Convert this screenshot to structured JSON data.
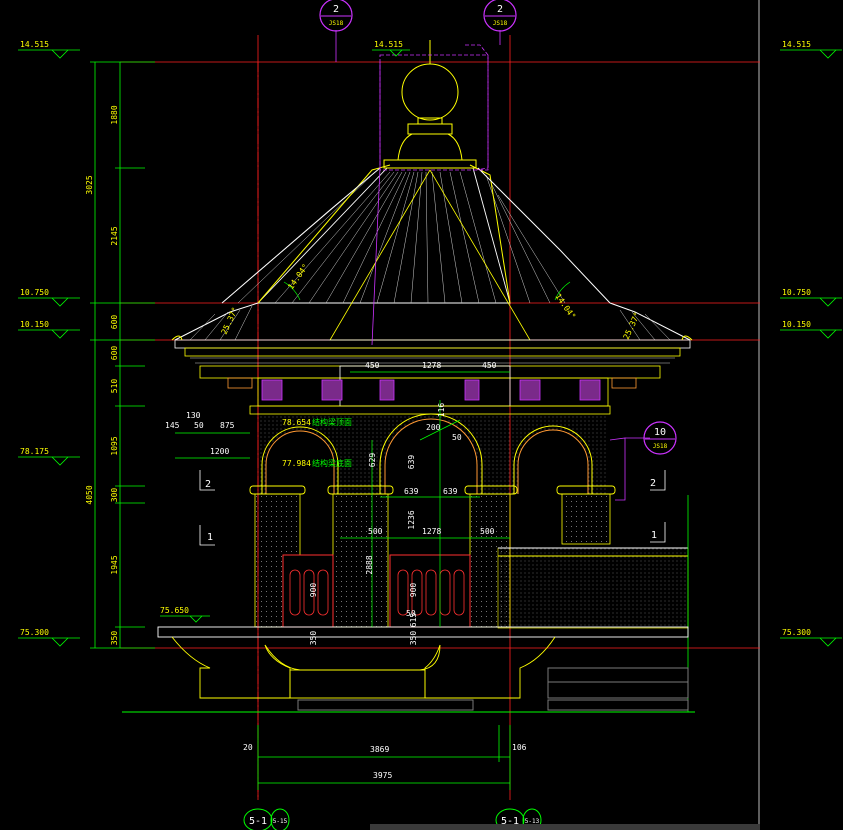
{
  "palette": {
    "background": "#000000",
    "structure": "#ffff00",
    "dimension": "#00ff00",
    "axis": "#ff2020",
    "callout": "#cc33ff",
    "roof": "#ffffff",
    "orange": "#ff9933",
    "gray": "#7a7a7a",
    "cyan": "#00ffff"
  },
  "callouts": {
    "top_left": {
      "num": "2",
      "sheet": "JS18"
    },
    "top_right": {
      "num": "2",
      "sheet": "JS18"
    },
    "right": {
      "num": "10",
      "sheet": "JS18"
    }
  },
  "levels": {
    "top": "14.515",
    "top_center": "14.515",
    "eave_upper": "10.750",
    "eave_lower": "10.150",
    "mid": "78.175",
    "base_left": "75.300",
    "base_center": "75.650"
  },
  "left_dims": {
    "outer": [
      "3025",
      "4050"
    ],
    "inner": [
      "1880",
      "2145",
      "600",
      "600",
      "510",
      "1095",
      "300",
      "1945",
      "350"
    ]
  },
  "dims": {
    "top_450_left": "450",
    "top_1278": "1278",
    "top_450_right": "450",
    "d145": "145",
    "d130": "130",
    "d50": "50",
    "d875": "875",
    "d1200": "1200",
    "mid_500_left": "500",
    "mid_1278": "1278",
    "mid_500_right": "500",
    "d639a": "639",
    "d639b": "639",
    "d1236": "1236",
    "d2888": "2888",
    "d900a": "900",
    "d900b": "900",
    "d350a": "350",
    "d350b": "350",
    "d116": "116",
    "d200": "200",
    "d50b": "50",
    "d629": "629",
    "d639v": "639",
    "d615": "615",
    "d50c": "50",
    "bottom_20": "20",
    "bottom_3869": "3869",
    "bottom_106": "106",
    "bottom_3975": "3975",
    "angle_left": "14.04°",
    "angle_right": "14.04°",
    "angle_eave_left": "25.37°",
    "angle_eave_right": "25.37°"
  },
  "labels": {
    "struct_top": "结构梁顶面",
    "struct_top_elev": "78.654",
    "struct_bottom": "结构梁底面",
    "struct_bottom_elev": "77.984",
    "section_left_upper": "2",
    "section_left_lower": "1",
    "section_right_upper": "2",
    "section_right_lower": "1"
  },
  "axes": {
    "left": "5-1",
    "left_sub": "5-15",
    "right": "5-1",
    "right_sub": "5-13"
  }
}
